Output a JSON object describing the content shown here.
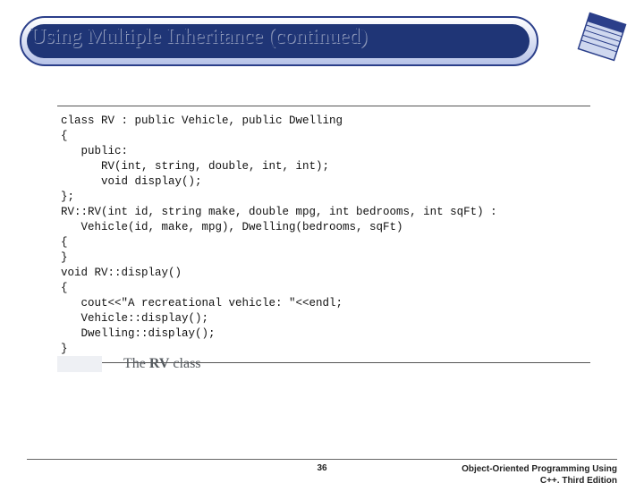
{
  "title": "Using Multiple Inheritance (continued)",
  "code": "class RV : public Vehicle, public Dwelling\n{\n   public:\n      RV(int, string, double, int, int);\n      void display();\n};\nRV::RV(int id, string make, double mpg, int bedrooms, int sqFt) :\n   Vehicle(id, make, mpg), Dwelling(bedrooms, sqFt)\n{\n}\nvoid RV::display()\n{\n   cout<<\"A recreational vehicle: \"<<endl;\n   Vehicle::display();\n   Dwelling::display();\n}",
  "caption_prefix": "The ",
  "caption_class": "RV",
  "caption_suffix": " class",
  "page_number": "36",
  "footer_line1": "Object-Oriented Programming Using",
  "footer_line2": "C++, Third Edition"
}
